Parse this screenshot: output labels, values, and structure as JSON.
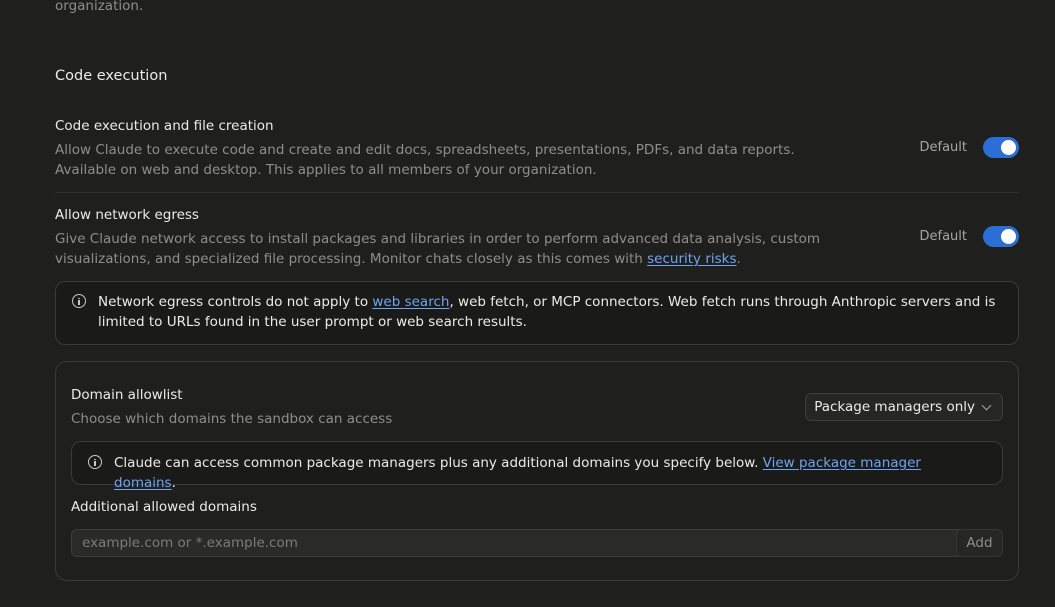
{
  "top_text": "organization.",
  "section": {
    "title": "Code execution"
  },
  "code_exec": {
    "title": "Code execution and file creation",
    "desc": "Allow Claude to execute code and create and edit docs, spreadsheets, presentations, PDFs, and data reports. Available on web and desktop. This applies to all members of your organization.",
    "label": "Default",
    "enabled": true
  },
  "network": {
    "title": "Allow network egress",
    "desc_prefix": "Give Claude network access to install packages and libraries in order to perform advanced data analysis, custom visualizations, and specialized file processing. Monitor chats closely as this comes with ",
    "desc_link": "security risks",
    "desc_suffix": ".",
    "label": "Default",
    "enabled": true
  },
  "egress_notice": {
    "prefix": "Network egress controls do not apply to ",
    "link": "web search",
    "suffix": ", web fetch, or MCP connectors. Web fetch runs through Anthropic servers and is limited to URLs found in the user prompt or web search results."
  },
  "domain_allowlist": {
    "title": "Domain allowlist",
    "subtitle": "Choose which domains the sandbox can access",
    "selected": "Package managers only",
    "info_prefix": "Claude can access common package managers plus any additional domains you specify below. ",
    "info_link": "View package manager domains",
    "info_suffix": ".",
    "additional_label": "Additional allowed domains",
    "input_placeholder": "example.com or *.example.com",
    "input_value": "",
    "add_label": "Add"
  },
  "colors": {
    "background": "#1f1f1e",
    "toggle_on": "#2b6fd6",
    "link": "#6ea4f2"
  },
  "icons": [
    "info-icon",
    "chevron-down-icon"
  ]
}
